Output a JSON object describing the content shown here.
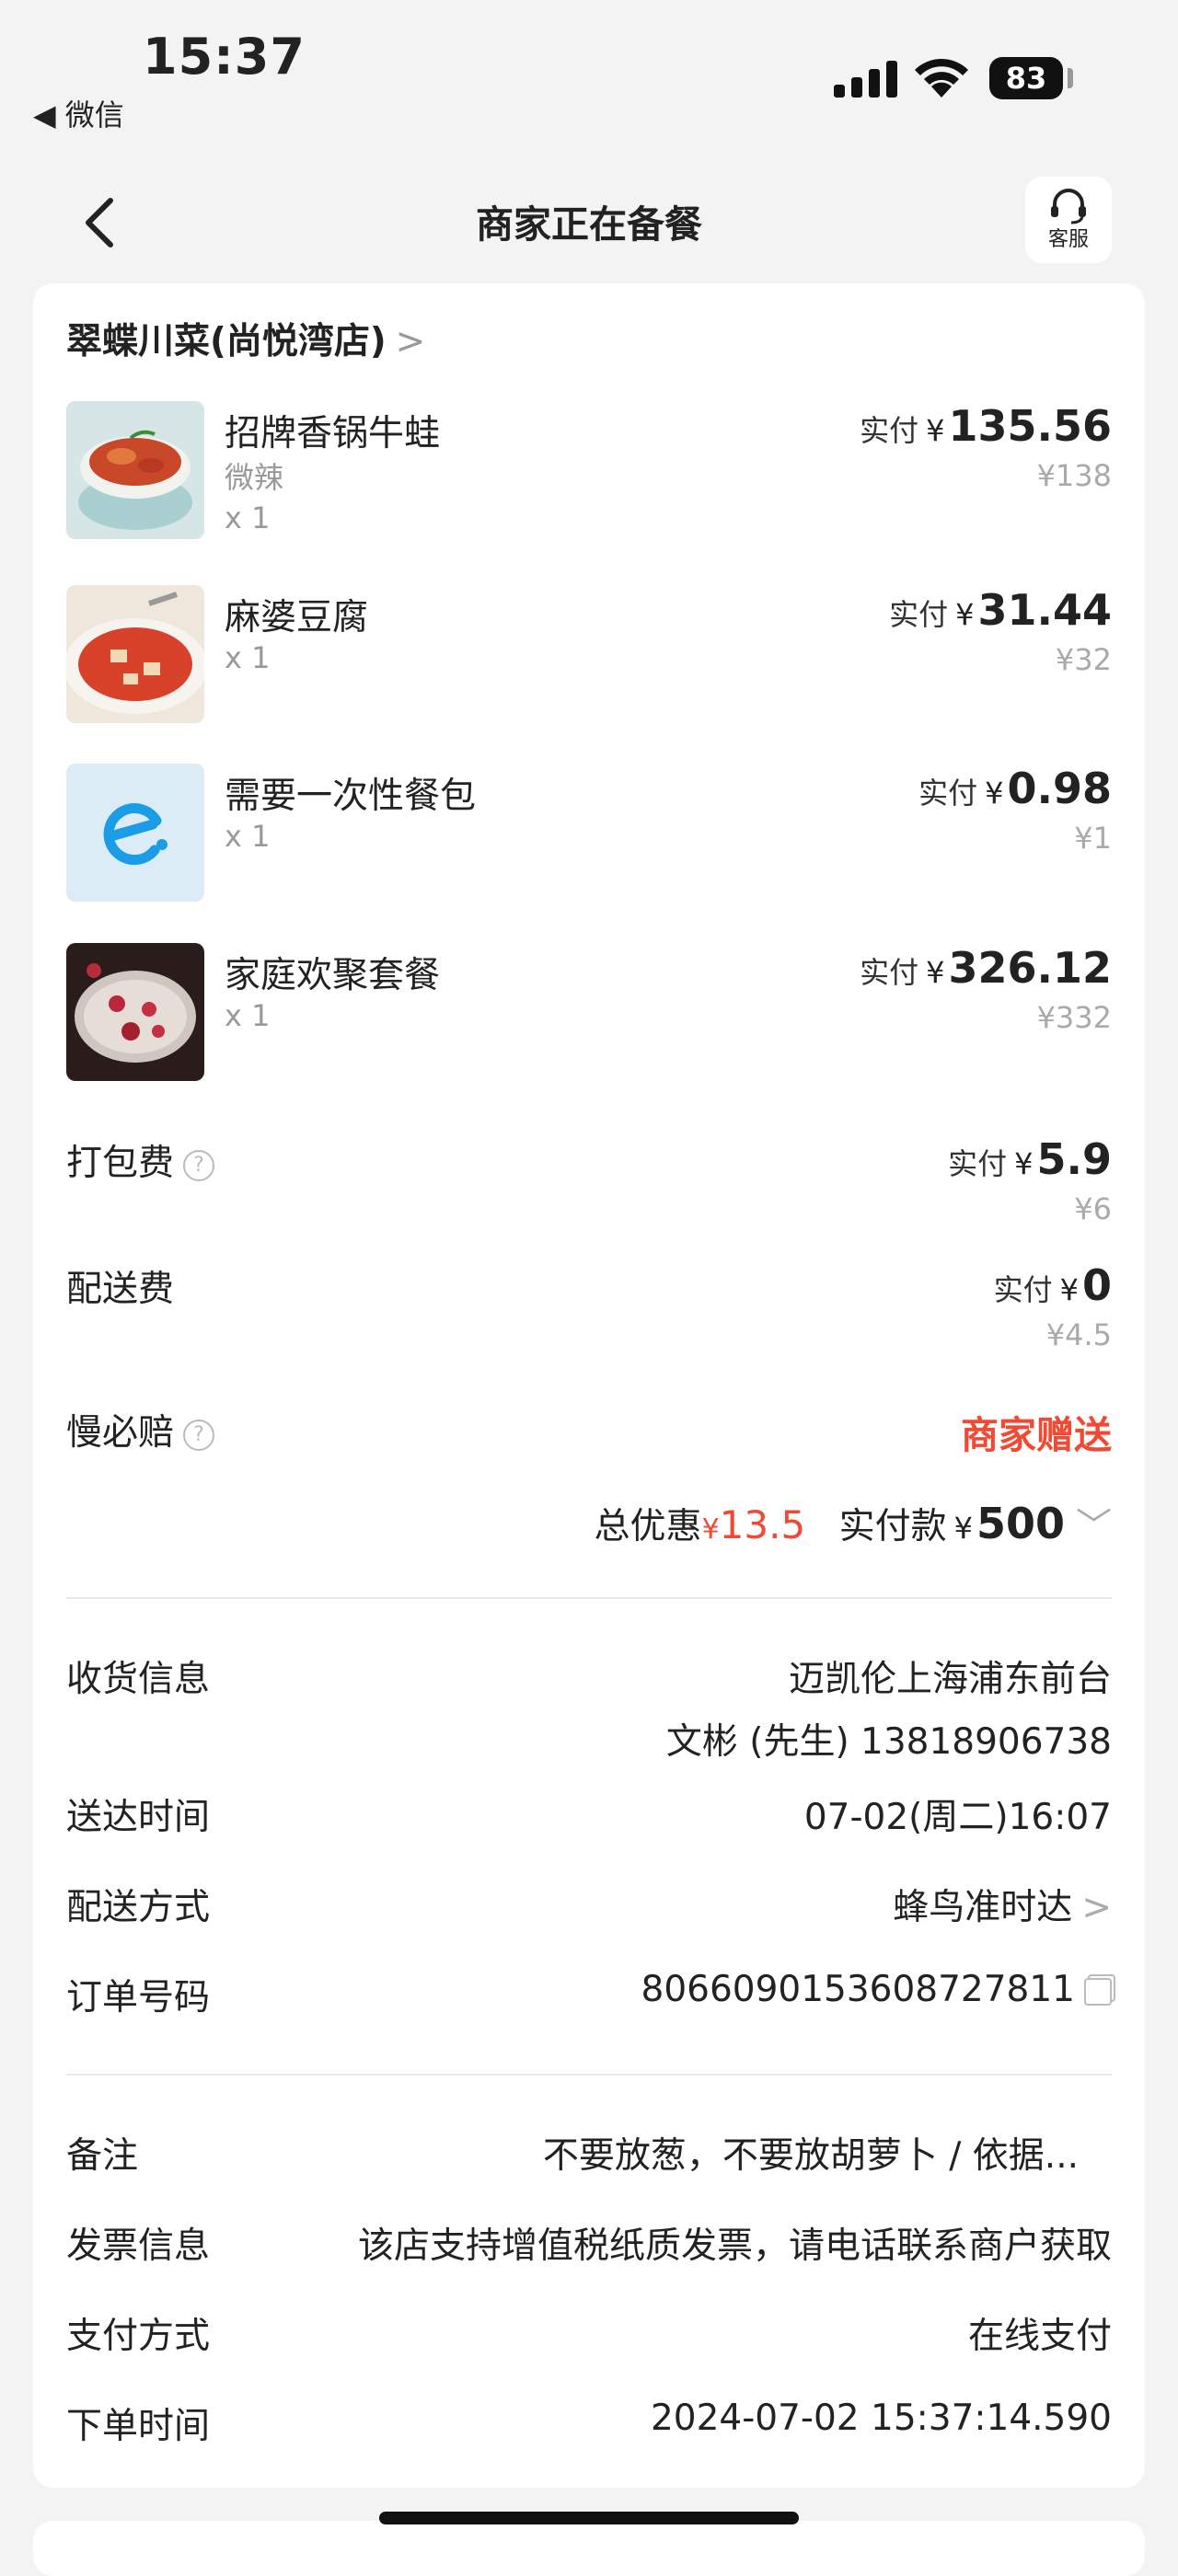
{
  "status_bar": {
    "time": "15:37",
    "back_app": "◀ 微信",
    "battery": "83"
  },
  "nav": {
    "title": "商家正在备餐",
    "customer_service": "客服"
  },
  "shop": {
    "name": "翠蝶川菜(尚悦湾店)",
    "chevron": ">"
  },
  "items": [
    {
      "name": "招牌香锅牛蛙",
      "spec": "微辣",
      "qty": "x 1",
      "paid_label": "实付",
      "yen": "¥",
      "paid": "135.56",
      "original": "¥138",
      "thumb_icon": "frog-dish-icon"
    },
    {
      "name": "麻婆豆腐",
      "spec": "",
      "qty": "x 1",
      "paid_label": "实付",
      "yen": "¥",
      "paid": "31.44",
      "original": "¥32",
      "thumb_icon": "tofu-dish-icon"
    },
    {
      "name": "需要一次性餐包",
      "spec": "",
      "qty": "x 1",
      "paid_label": "实付",
      "yen": "¥",
      "paid": "0.98",
      "original": "¥1",
      "thumb_icon": "eleme-logo-icon"
    },
    {
      "name": "家庭欢聚套餐",
      "spec": "",
      "qty": "x 1",
      "paid_label": "实付",
      "yen": "¥",
      "paid": "326.12",
      "original": "¥332",
      "thumb_icon": "hotpot-dish-icon"
    }
  ],
  "fees": {
    "packing": {
      "label": "打包费",
      "paid_label": "实付",
      "yen": "¥",
      "paid": "5.9",
      "original": "¥6"
    },
    "delivery": {
      "label": "配送费",
      "paid_label": "实付",
      "yen": "¥",
      "paid": "0",
      "original": "¥4.5"
    },
    "slow_comp": {
      "label": "慢必赔",
      "value": "商家赠送"
    }
  },
  "total": {
    "discount_label": "总优惠",
    "discount_yen": "¥",
    "discount": "13.5",
    "pay_label": "实付款",
    "pay_yen": "¥",
    "pay": "500"
  },
  "delivery_info": [
    {
      "label": "收货信息",
      "value": "迈凯伦上海浦东前台",
      "value2": "文彬 (先生) 13818906738"
    },
    {
      "label": "送达时间",
      "value": "07-02(周二)16:07"
    },
    {
      "label": "配送方式",
      "value": "蜂鸟准时达"
    },
    {
      "label": "订单号码",
      "value": "8066090153608727811"
    }
  ],
  "extra_info": [
    {
      "label": "备注",
      "value": "不要放葱，不要放胡萝卜 / 依据..."
    },
    {
      "label": "发票信息",
      "value": "该店支持增值税纸质发票，请电话联系商户获取"
    },
    {
      "label": "支付方式",
      "value": "在线支付"
    },
    {
      "label": "下单时间",
      "value": "2024-07-02 15:37:14.590"
    }
  ],
  "colors": {
    "accent_red": "#f04a35",
    "eleme_blue": "#1a9ce6",
    "background": "#f3f3f3"
  }
}
